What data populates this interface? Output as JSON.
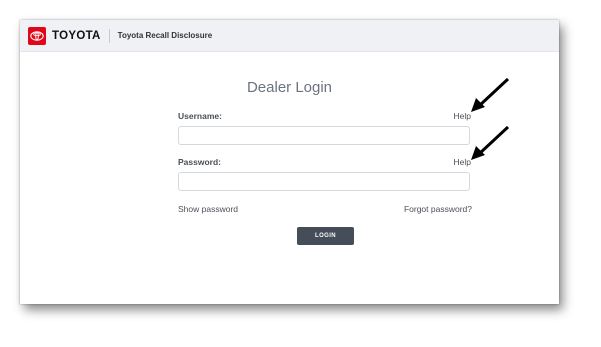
{
  "header": {
    "brand": "TOYOTA",
    "app_title": "Toyota Recall Disclosure",
    "brand_color": "#e00818"
  },
  "login": {
    "title": "Dealer Login",
    "username_label": "Username:",
    "password_label": "Password:",
    "help_label": "Help",
    "username_value": "",
    "password_value": "",
    "show_password": "Show password",
    "forgot_password": "Forgot password?",
    "submit": "LOGIN"
  },
  "annotations": {
    "arrow_icon": "arrow-pointing-down-left",
    "arrow_color": "#000000"
  }
}
